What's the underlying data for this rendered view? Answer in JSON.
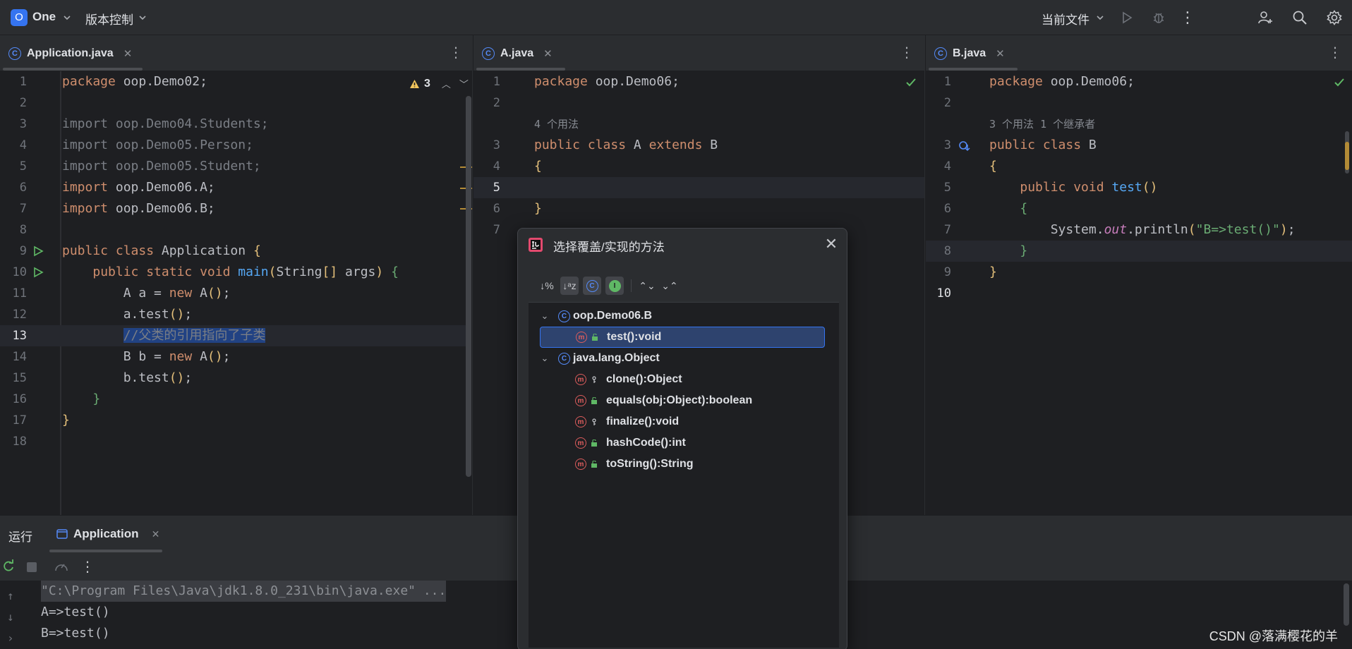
{
  "topbar": {
    "project_badge": "O",
    "project_name": "One",
    "vcs_label": "版本控制",
    "current_file": "当前文件"
  },
  "panes": {
    "left": {
      "tab_label": "Application.java",
      "warnings": "3",
      "lines": [
        "package oop.Demo02;",
        "",
        "import oop.Demo04.Students;",
        "import oop.Demo05.Person;",
        "import oop.Demo05.Student;",
        "import oop.Demo06.A;",
        "import oop.Demo06.B;",
        "",
        "public class Application {",
        "    public static void main(String[] args) {",
        "        A a = new A();",
        "        a.test();",
        "        //父类的引用指向了子类",
        "        B b = new A();",
        "        b.test();",
        "    }",
        "}",
        ""
      ],
      "line_numbers": [
        "1",
        "2",
        "3",
        "4",
        "5",
        "6",
        "7",
        "8",
        "9",
        "10",
        "11",
        "12",
        "13",
        "14",
        "15",
        "16",
        "17",
        "18"
      ]
    },
    "middle": {
      "tab_label": "A.java",
      "usages_hint": "4 个用法",
      "line_numbers": [
        "1",
        "2",
        "3",
        "4",
        "5",
        "6",
        "7"
      ]
    },
    "right": {
      "tab_label": "B.java",
      "usages_hint": "3 个用法  1 个继承者",
      "line_numbers": [
        "1",
        "2",
        "3",
        "4",
        "5",
        "6",
        "7",
        "8",
        "9",
        "10"
      ]
    }
  },
  "dialog": {
    "title": "选择覆盖/实现的方法",
    "groups": [
      {
        "class_name": "oop.Demo06.B",
        "methods": [
          {
            "label": "test():void",
            "access": "public",
            "selected": true
          }
        ]
      },
      {
        "class_name": "java.lang.Object",
        "methods": [
          {
            "label": "clone():Object",
            "access": "protected",
            "selected": false
          },
          {
            "label": "equals(obj:Object):boolean",
            "access": "public",
            "selected": false
          },
          {
            "label": "finalize():void",
            "access": "protected",
            "selected": false
          },
          {
            "label": "hashCode():int",
            "access": "public",
            "selected": false
          },
          {
            "label": "toString():String",
            "access": "public",
            "selected": false
          }
        ]
      }
    ]
  },
  "runpanel": {
    "run_label": "运行",
    "tab_label": "Application",
    "console": [
      "\"C:\\Program Files\\Java\\jdk1.8.0_231\\bin\\java.exe\" ...",
      "A=>test()",
      "B=>test()"
    ]
  },
  "watermark": "CSDN @落满樱花的羊"
}
